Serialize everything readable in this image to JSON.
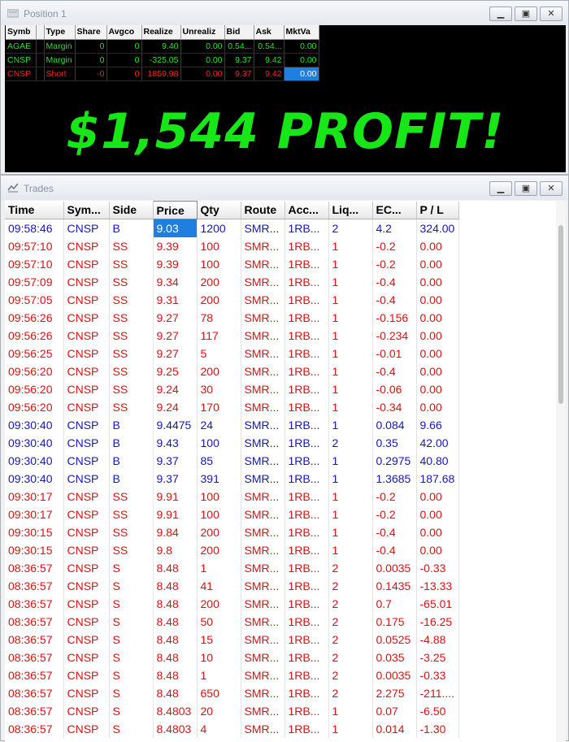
{
  "position_window": {
    "title": "Position 1",
    "columns": [
      "Symb",
      "",
      "Type",
      "Share",
      "Avgco",
      "Realize",
      "Unrealiz",
      "Bid",
      "Ask",
      "MktVa"
    ],
    "rows": [
      {
        "style": "green",
        "cells": [
          "AGAE",
          "",
          "Margin",
          "0",
          "0",
          "9.40",
          "0.00",
          "0.54...",
          "0.54...",
          "0.00"
        ]
      },
      {
        "style": "green",
        "cells": [
          "CNSP",
          "",
          "Margin",
          "0",
          "0",
          "-325.05",
          "0.00",
          "9.37",
          "9.42",
          "0.00"
        ]
      },
      {
        "style": "red",
        "cells": [
          "CNSP",
          "",
          "Short",
          "-0",
          "0",
          "1859.98",
          "0.00",
          "9.37",
          "9.42",
          "0.00"
        ]
      }
    ],
    "banner": "$1,544 PROFIT!",
    "colors": {
      "banner": "#17e617",
      "long_text": "#28e028",
      "short_text": "#ff2020",
      "selection": "#1e7fe0"
    }
  },
  "trades_window": {
    "title": "Trades",
    "columns": [
      "Time",
      "Sym...",
      "Side",
      "Price",
      "Qty",
      "Route",
      "Acc...",
      "Liq...",
      "EC...",
      "P / L"
    ],
    "rows": [
      {
        "side_class": "buy",
        "cells": [
          "09:58:46",
          "CNSP",
          "B",
          "9.03",
          "1200",
          "SMR...",
          "1RB...",
          "2",
          "4.2",
          "324.00"
        ]
      },
      {
        "side_class": "sell",
        "cells": [
          "09:57:10",
          "CNSP",
          "SS",
          "9.39",
          "100",
          "SMR...",
          "1RB...",
          "1",
          "-0.2",
          "0.00"
        ]
      },
      {
        "side_class": "sell",
        "cells": [
          "09:57:10",
          "CNSP",
          "SS",
          "9.39",
          "100",
          "SMR...",
          "1RB...",
          "1",
          "-0.2",
          "0.00"
        ]
      },
      {
        "side_class": "sell",
        "cells": [
          "09:57:09",
          "CNSP",
          "SS",
          "9.34",
          "200",
          "SMR...",
          "1RB...",
          "1",
          "-0.4",
          "0.00"
        ]
      },
      {
        "side_class": "sell",
        "cells": [
          "09:57:05",
          "CNSP",
          "SS",
          "9.31",
          "200",
          "SMR...",
          "1RB...",
          "1",
          "-0.4",
          "0.00"
        ]
      },
      {
        "side_class": "sell",
        "cells": [
          "09:56:26",
          "CNSP",
          "SS",
          "9.27",
          "78",
          "SMR...",
          "1RB...",
          "1",
          "-0.156",
          "0.00"
        ]
      },
      {
        "side_class": "sell",
        "cells": [
          "09:56:26",
          "CNSP",
          "SS",
          "9.27",
          "117",
          "SMR...",
          "1RB...",
          "1",
          "-0.234",
          "0.00"
        ]
      },
      {
        "side_class": "sell",
        "cells": [
          "09:56:25",
          "CNSP",
          "SS",
          "9.27",
          "5",
          "SMR...",
          "1RB...",
          "1",
          "-0.01",
          "0.00"
        ]
      },
      {
        "side_class": "sell",
        "cells": [
          "09:56:20",
          "CNSP",
          "SS",
          "9.25",
          "200",
          "SMR...",
          "1RB...",
          "1",
          "-0.4",
          "0.00"
        ]
      },
      {
        "side_class": "sell",
        "cells": [
          "09:56:20",
          "CNSP",
          "SS",
          "9.24",
          "30",
          "SMR...",
          "1RB...",
          "1",
          "-0.06",
          "0.00"
        ]
      },
      {
        "side_class": "sell",
        "cells": [
          "09:56:20",
          "CNSP",
          "SS",
          "9.24",
          "170",
          "SMR...",
          "1RB...",
          "1",
          "-0.34",
          "0.00"
        ]
      },
      {
        "side_class": "buy",
        "cells": [
          "09:30:40",
          "CNSP",
          "B",
          "9.4475",
          "24",
          "SMR...",
          "1RB...",
          "1",
          "0.084",
          "9.66"
        ]
      },
      {
        "side_class": "buy",
        "cells": [
          "09:30:40",
          "CNSP",
          "B",
          "9.43",
          "100",
          "SMR...",
          "1RB...",
          "2",
          "0.35",
          "42.00"
        ]
      },
      {
        "side_class": "buy",
        "cells": [
          "09:30:40",
          "CNSP",
          "B",
          "9.37",
          "85",
          "SMR...",
          "1RB...",
          "1",
          "0.2975",
          "40.80"
        ]
      },
      {
        "side_class": "buy",
        "cells": [
          "09:30:40",
          "CNSP",
          "B",
          "9.37",
          "391",
          "SMR...",
          "1RB...",
          "1",
          "1.3685",
          "187.68"
        ]
      },
      {
        "side_class": "sell",
        "cells": [
          "09:30:17",
          "CNSP",
          "SS",
          "9.91",
          "100",
          "SMR...",
          "1RB...",
          "1",
          "-0.2",
          "0.00"
        ]
      },
      {
        "side_class": "sell",
        "cells": [
          "09:30:17",
          "CNSP",
          "SS",
          "9.91",
          "100",
          "SMR...",
          "1RB...",
          "1",
          "-0.2",
          "0.00"
        ]
      },
      {
        "side_class": "sell",
        "cells": [
          "09:30:15",
          "CNSP",
          "SS",
          "9.84",
          "200",
          "SMR...",
          "1RB...",
          "1",
          "-0.4",
          "0.00"
        ]
      },
      {
        "side_class": "sell",
        "cells": [
          "09:30:15",
          "CNSP",
          "SS",
          "9.8",
          "200",
          "SMR...",
          "1RB...",
          "1",
          "-0.4",
          "0.00"
        ]
      },
      {
        "side_class": "sell",
        "cells": [
          "08:36:57",
          "CNSP",
          "S",
          "8.48",
          "1",
          "SMR...",
          "1RB...",
          "2",
          "0.0035",
          "-0.33"
        ]
      },
      {
        "side_class": "sell",
        "cells": [
          "08:36:57",
          "CNSP",
          "S",
          "8.48",
          "41",
          "SMR...",
          "1RB...",
          "2",
          "0.1435",
          "-13.33"
        ]
      },
      {
        "side_class": "sell",
        "cells": [
          "08:36:57",
          "CNSP",
          "S",
          "8.48",
          "200",
          "SMR...",
          "1RB...",
          "2",
          "0.7",
          "-65.01"
        ]
      },
      {
        "side_class": "sell",
        "cells": [
          "08:36:57",
          "CNSP",
          "S",
          "8.48",
          "50",
          "SMR...",
          "1RB...",
          "2",
          "0.175",
          "-16.25"
        ]
      },
      {
        "side_class": "sell",
        "cells": [
          "08:36:57",
          "CNSP",
          "S",
          "8.48",
          "15",
          "SMR...",
          "1RB...",
          "2",
          "0.0525",
          "-4.88"
        ]
      },
      {
        "side_class": "sell",
        "cells": [
          "08:36:57",
          "CNSP",
          "S",
          "8.48",
          "10",
          "SMR...",
          "1RB...",
          "2",
          "0.035",
          "-3.25"
        ]
      },
      {
        "side_class": "sell",
        "cells": [
          "08:36:57",
          "CNSP",
          "S",
          "8.48",
          "1",
          "SMR...",
          "1RB...",
          "2",
          "0.0035",
          "-0.33"
        ]
      },
      {
        "side_class": "sell",
        "cells": [
          "08:36:57",
          "CNSP",
          "S",
          "8.48",
          "650",
          "SMR...",
          "1RB...",
          "2",
          "2.275",
          "-211...."
        ]
      },
      {
        "side_class": "sell",
        "cells": [
          "08:36:57",
          "CNSP",
          "S",
          "8.4803",
          "20",
          "SMR...",
          "1RB...",
          "1",
          "0.07",
          "-6.50"
        ]
      },
      {
        "side_class": "sell",
        "cells": [
          "08:36:57",
          "CNSP",
          "S",
          "8.4803",
          "4",
          "SMR...",
          "1RB...",
          "1",
          "0.014",
          "-1.30"
        ]
      }
    ],
    "colors": {
      "buy_text": "#1515c8",
      "sell_text": "#e01010",
      "selection": "#1e7fe0"
    }
  },
  "window_buttons": {
    "minimize_icon": "minimize-icon",
    "maximize_icon": "maximize-icon",
    "close_icon": "close-icon"
  }
}
